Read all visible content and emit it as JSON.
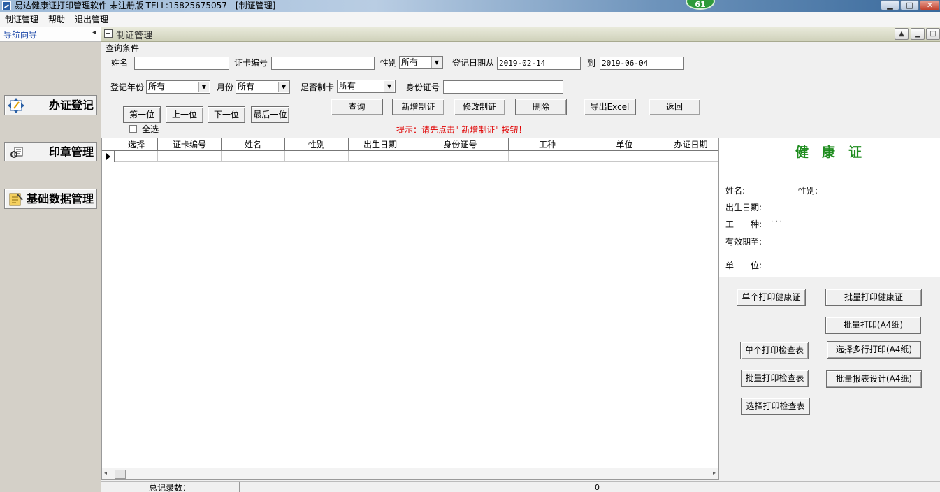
{
  "window": {
    "title": "易达健康证打印管理软件 未注册版 TELL:15825675057 - [制证管理]",
    "badge": "61",
    "min_glyph": "▁",
    "max_glyph": "□",
    "close_glyph": "✕"
  },
  "menu": {
    "items": [
      "制证管理",
      "帮助",
      "退出管理"
    ]
  },
  "nav": {
    "title": "导航向导",
    "collapse_glyph": "◂",
    "buttons": [
      "办证登记",
      "印章管理",
      "基础数据管理"
    ]
  },
  "inner": {
    "title": "制证管理",
    "btn_up": "▲",
    "btn_min": "▁",
    "btn_max": "□"
  },
  "query": {
    "group_title": "查询条件",
    "name_label": "姓名",
    "name_value": "",
    "card_no_label": "证卡编号",
    "card_no_value": "",
    "gender_label": "性别",
    "gender_value": "所有",
    "date_from_label": "登记日期从",
    "date_from_value": "2019-02-14",
    "date_to_label": "到",
    "date_to_value": "2019-06-04",
    "year_label": "登记年份",
    "year_value": "所有",
    "month_label": "月份",
    "month_value": "所有",
    "made_label": "是否制卡",
    "made_value": "所有",
    "id_label": "身份证号",
    "id_value": "",
    "dropdown_arrow": "▼",
    "select_all_label": "全选",
    "hint": "提示：请先点击\" 新增制证\" 按钮！"
  },
  "nav_buttons": {
    "first": "第一位",
    "prev": "上一位",
    "next": "下一位",
    "last": "最后一位"
  },
  "actions": {
    "search": "查询",
    "add": "新增制证",
    "edit": "修改制证",
    "delete": "删除",
    "export": "导出Excel",
    "back": "返回"
  },
  "grid": {
    "columns": [
      "选择",
      "证卡编号",
      "姓名",
      "性别",
      "出生日期",
      "身份证号",
      "工种",
      "单位",
      "办证日期"
    ],
    "rows": [],
    "scroll_left": "◂",
    "scroll_right": "▸"
  },
  "status": {
    "total_label": "总记录数：",
    "total_value": "0"
  },
  "card": {
    "title": "健康证",
    "name_label": "姓名:",
    "gender_label": "性别:",
    "birth_label": "出生日期:",
    "job_label": "工　　种:",
    "job_value": "· · ·",
    "valid_label": "有效期至:",
    "unit_label": "单　　位:"
  },
  "print": {
    "single_cert": "单个打印健康证",
    "batch_cert": "批量打印健康证",
    "batch_a4": "批量打印(A4纸)",
    "single_check": "单个打印检查表",
    "multi_a4": "选择多行打印(A4纸)",
    "batch_check": "批量打印检查表",
    "report_design": "批量报表设计(A4纸)",
    "select_check": "选择打印检查表"
  }
}
